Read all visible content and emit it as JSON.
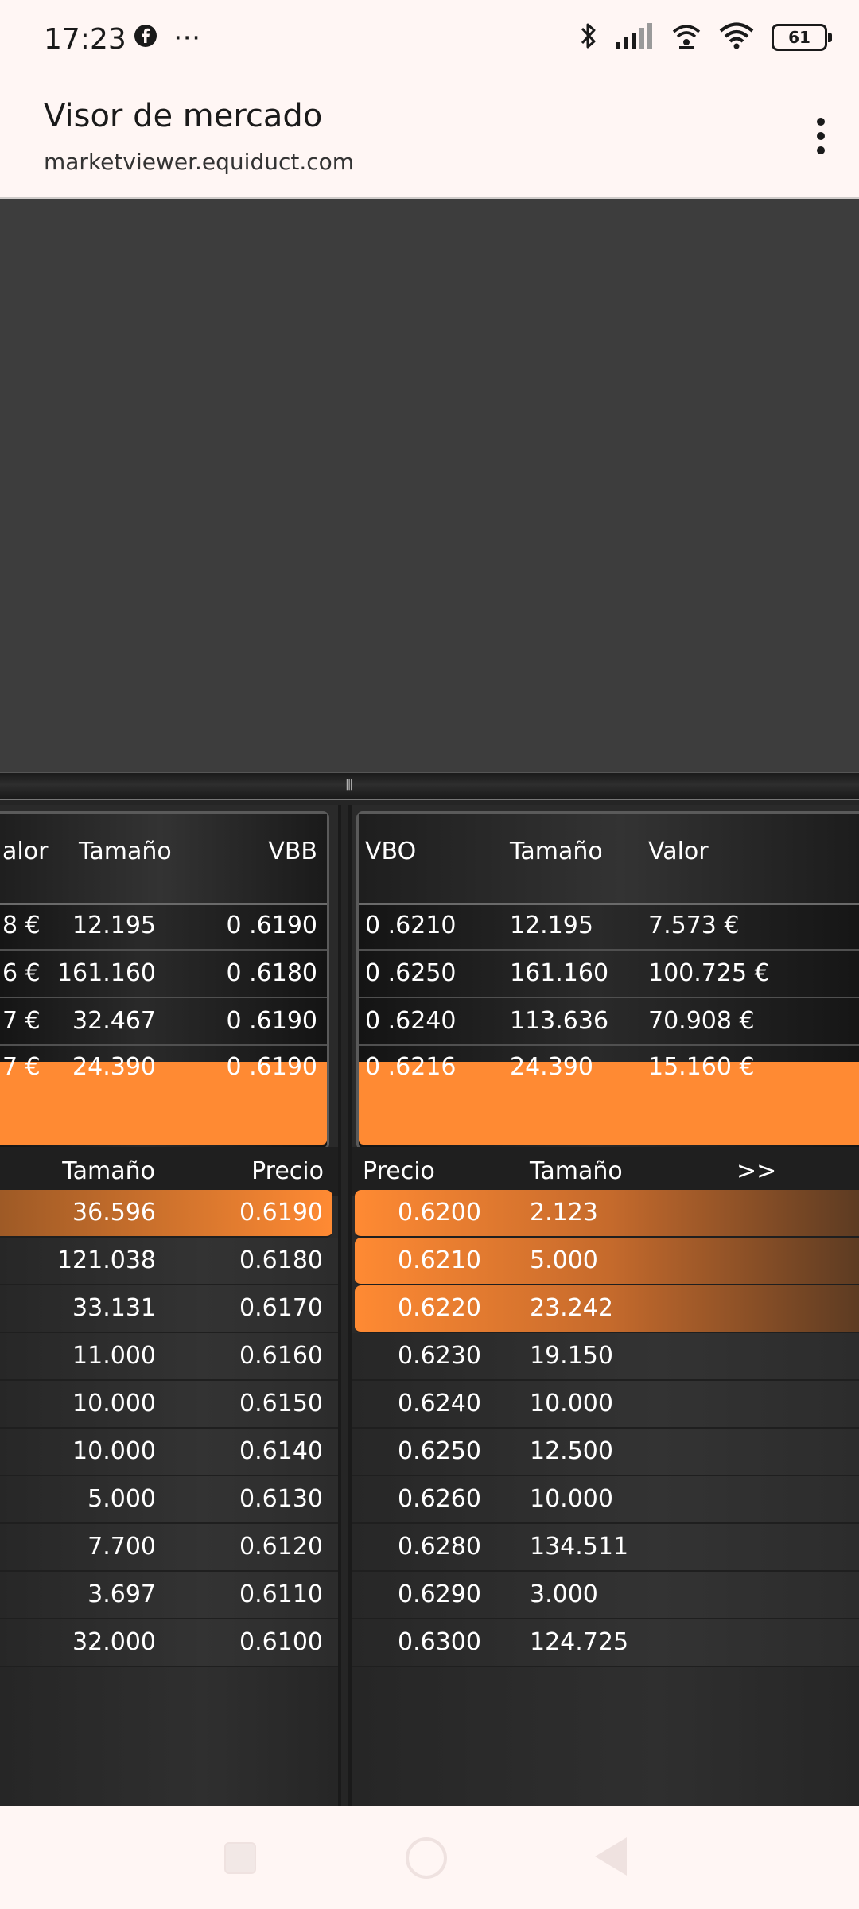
{
  "status_bar": {
    "time": "17:23",
    "more": "⋯",
    "battery": "61"
  },
  "header": {
    "title": "Visor de mercado",
    "url": "marketviewer.equiduct.com"
  },
  "bid_summary": {
    "headers": {
      "valor": "alor",
      "tamano": "Tamaño",
      "vbb": "VBB"
    },
    "rows": [
      {
        "valor": "8 €",
        "tamano": "12.195",
        "vbb": "0 .6190"
      },
      {
        "valor": "6 €",
        "tamano": "161.160",
        "vbb": "0 .6180"
      },
      {
        "valor": "7 €",
        "tamano": "32.467",
        "vbb": "0 .6190"
      },
      {
        "valor": "7 €",
        "tamano": "24.390",
        "vbb": "0 .6190"
      }
    ]
  },
  "ask_summary": {
    "headers": {
      "vbo": "VBO",
      "tamano": "Tamaño",
      "valor": "Valor"
    },
    "rows": [
      {
        "vbo": "0 .6210",
        "tamano": "12.195",
        "valor": "7.573 €"
      },
      {
        "vbo": "0 .6250",
        "tamano": "161.160",
        "valor": "100.725 €"
      },
      {
        "vbo": "0 .6240",
        "tamano": "113.636",
        "valor": "70.908 €"
      },
      {
        "vbo": "0 .6216",
        "tamano": "24.390",
        "valor": "15.160 €"
      }
    ]
  },
  "bid_book": {
    "headers": {
      "tamano": "Tamaño",
      "precio": "Precio"
    },
    "rows": [
      {
        "tamano": "36.596",
        "precio": "0.6190"
      },
      {
        "tamano": "121.038",
        "precio": "0.6180"
      },
      {
        "tamano": "33.131",
        "precio": "0.6170"
      },
      {
        "tamano": "11.000",
        "precio": "0.6160"
      },
      {
        "tamano": "10.000",
        "precio": "0.6150"
      },
      {
        "tamano": "10.000",
        "precio": "0.6140"
      },
      {
        "tamano": "5.000",
        "precio": "0.6130"
      },
      {
        "tamano": "7.700",
        "precio": "0.6120"
      },
      {
        "tamano": "3.697",
        "precio": "0.6110"
      },
      {
        "tamano": "32.000",
        "precio": "0.6100"
      }
    ]
  },
  "ask_book": {
    "headers": {
      "precio": "Precio",
      "tamano": "Tamaño",
      "more": ">>"
    },
    "rows": [
      {
        "precio": "0.6200",
        "tamano": "2.123"
      },
      {
        "precio": "0.6210",
        "tamano": "5.000"
      },
      {
        "precio": "0.6220",
        "tamano": "23.242"
      },
      {
        "precio": "0.6230",
        "tamano": "19.150"
      },
      {
        "precio": "0.6240",
        "tamano": "10.000"
      },
      {
        "precio": "0.6250",
        "tamano": "12.500"
      },
      {
        "precio": "0.6260",
        "tamano": "10.000"
      },
      {
        "precio": "0.6280",
        "tamano": "134.511"
      },
      {
        "precio": "0.6290",
        "tamano": "3.000"
      },
      {
        "precio": "0.6300",
        "tamano": "124.725"
      }
    ]
  }
}
